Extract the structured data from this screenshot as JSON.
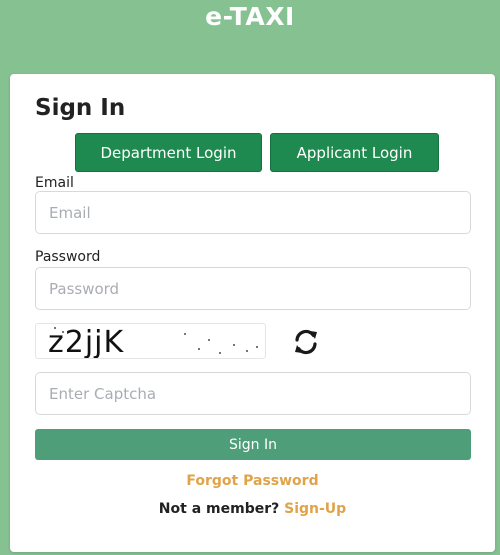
{
  "header": {
    "app_title": "e-TAXI"
  },
  "form": {
    "title": "Sign In",
    "department_login_label": "Department Login",
    "applicant_login_label": "Applicant Login",
    "email_label": "Email",
    "email_placeholder": "Email",
    "email_value": "",
    "password_label": "Password",
    "password_placeholder": "Password",
    "password_value": "",
    "captcha_text": "z2jjK",
    "captcha_placeholder": "Enter Captcha",
    "captcha_value": "",
    "signin_label": "Sign In",
    "forgot_password_label": "Forgot Password",
    "not_member_text": "Not a member?",
    "signup_label": "Sign-Up"
  },
  "icons": {
    "refresh": "refresh-icon"
  },
  "colors": {
    "background": "#86c291",
    "primary_button": "#1e8a4f",
    "signin_button": "#4e9e79",
    "link": "#e0a34a"
  }
}
